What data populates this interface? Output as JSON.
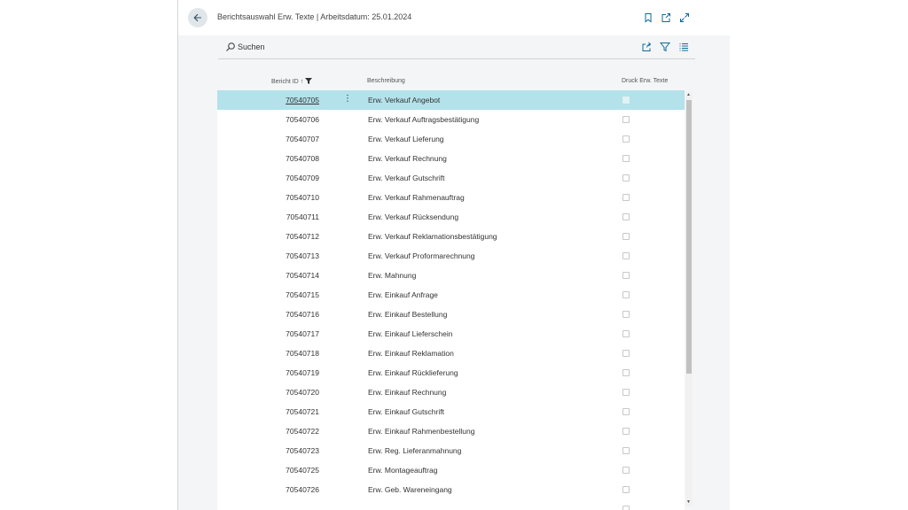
{
  "header": {
    "title": "Berichtsauswahl Erw. Texte | Arbeitsdatum: 25.01.2024",
    "icons": [
      "back-arrow-icon",
      "bookmark-icon",
      "open-new-window-icon",
      "expand-icon"
    ]
  },
  "toolbar": {
    "search_label": "Suchen",
    "icons": [
      "search-icon",
      "share-icon",
      "filter-icon",
      "list-view-icon"
    ]
  },
  "columns": {
    "id": "Bericht ID",
    "id_sort": "↑",
    "description": "Beschreibung",
    "print": "Druck Erw. Texte"
  },
  "rows": [
    {
      "id": "70540705",
      "desc": "Erw. Verkauf Angebot"
    },
    {
      "id": "70540706",
      "desc": "Erw. Verkauf Auftragsbestätigung"
    },
    {
      "id": "70540707",
      "desc": "Erw. Verkauf Lieferung"
    },
    {
      "id": "70540708",
      "desc": "Erw. Verkauf Rechnung"
    },
    {
      "id": "70540709",
      "desc": "Erw. Verkauf Gutschrift"
    },
    {
      "id": "70540710",
      "desc": "Erw. Verkauf Rahmenauftrag"
    },
    {
      "id": "70540711",
      "desc": "Erw. Verkauf Rücksendung"
    },
    {
      "id": "70540712",
      "desc": "Erw. Verkauf Reklamationsbestätigung"
    },
    {
      "id": "70540713",
      "desc": "Erw. Verkauf Proformarechnung"
    },
    {
      "id": "70540714",
      "desc": "Erw. Mahnung"
    },
    {
      "id": "70540715",
      "desc": "Erw. Einkauf Anfrage"
    },
    {
      "id": "70540716",
      "desc": "Erw. Einkauf Bestellung"
    },
    {
      "id": "70540717",
      "desc": "Erw. Einkauf Lieferschein"
    },
    {
      "id": "70540718",
      "desc": "Erw. Einkauf Reklamation"
    },
    {
      "id": "70540719",
      "desc": "Erw. Einkauf Rücklieferung"
    },
    {
      "id": "70540720",
      "desc": "Erw. Einkauf Rechnung"
    },
    {
      "id": "70540721",
      "desc": "Erw. Einkauf Gutschrift"
    },
    {
      "id": "70540722",
      "desc": "Erw. Einkauf Rahmenbestellung"
    },
    {
      "id": "70540723",
      "desc": "Erw. Reg. Lieferanmahnung"
    },
    {
      "id": "70540725",
      "desc": "Erw. Montageauftrag"
    },
    {
      "id": "70540726",
      "desc": "Erw. Geb. Wareneingang"
    }
  ],
  "colors": {
    "accent": "#0e6a9a",
    "selected_row": "#b3e2ea"
  }
}
